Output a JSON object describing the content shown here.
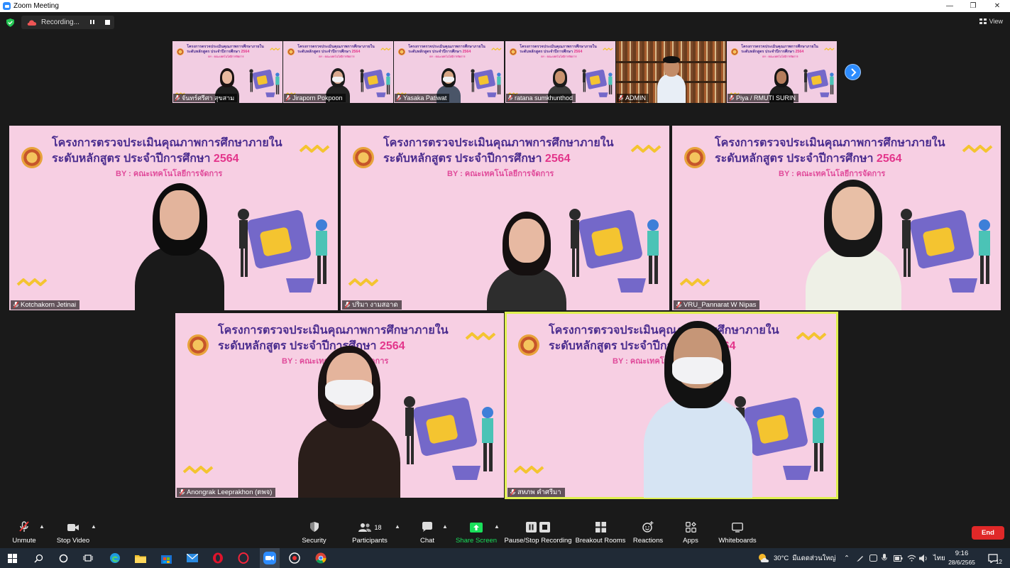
{
  "window": {
    "title": "Zoom Meeting"
  },
  "recording": {
    "status": "Recording..."
  },
  "view": {
    "label": "View"
  },
  "slide": {
    "line1": "โครงการตรวจประเมินคุณภาพการศึกษาภายใน",
    "line2": "ระดับหลักสูตร ประจำปีการศึกษา",
    "year": "2564",
    "sub": "BY : คณะเทคโนโลยีการจัดการ"
  },
  "thumbnails": [
    {
      "name": "จันทร์ศรีศา สุขสาม"
    },
    {
      "name": "Jiraporn Pokpoon"
    },
    {
      "name": "Yasaka Patiwat"
    },
    {
      "name": "ratana sumkhunthod"
    },
    {
      "name": "ADMIN"
    },
    {
      "name": "Piya / RMUTI SURIN"
    }
  ],
  "tiles": [
    {
      "name": "Kotchakorn Jetinai"
    },
    {
      "name": "ปริมา งามสอาด"
    },
    {
      "name": "VRU_Pannarat W Nipas"
    },
    {
      "name": "Anongrak Leeprakhon (ตพจ)"
    },
    {
      "name": "สหภพ คำศรีมา"
    }
  ],
  "toolbar": {
    "unmute": "Unmute",
    "stop_video": "Stop Video",
    "security": "Security",
    "participants": "Participants",
    "participants_count": "18",
    "chat": "Chat",
    "share_screen": "Share Screen",
    "pause_stop": "Pause/Stop Recording",
    "breakout": "Breakout Rooms",
    "reactions": "Reactions",
    "apps": "Apps",
    "whiteboards": "Whiteboards",
    "end": "End"
  },
  "taskbar": {
    "weather_temp": "30°C",
    "weather_desc": "มีแดดส่วนใหญ่",
    "lang": "ไทย",
    "time": "9:16",
    "date": "28/6/2565",
    "notif_count": "12"
  },
  "colors": {
    "accent": "#2d8cff",
    "end": "#e02828",
    "share": "#19e05b",
    "active_speaker": "#dff04f"
  }
}
